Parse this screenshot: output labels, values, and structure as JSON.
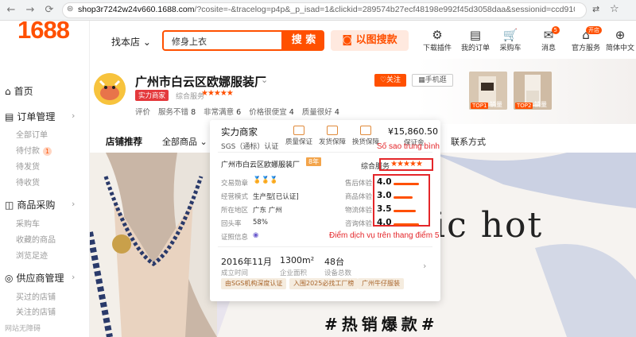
{
  "browser": {
    "url_host": "shop3r7242w24v660.1688.com",
    "url_rest": "/?cosite=-&tracelog=p4p&_p_isad=1&clickid=289574b27ecf48198e992f45d3058daa&sessionid=ccd91063c73c9895..."
  },
  "sidebar": {
    "logo": "1688",
    "home": "首页",
    "orders_head": "订单管理",
    "orders_items": [
      "全部订单",
      "待付款",
      "待发货",
      "待收货"
    ],
    "pending_count": "1",
    "purchase_head": "商品采购",
    "purchase_items": [
      "采购车",
      "收藏的商品",
      "浏览足迹"
    ],
    "supplier_head": "供应商管理",
    "supplier_items": [
      "买过的店铺",
      "关注的店铺"
    ],
    "watermark": "网站无障碍"
  },
  "header": {
    "find_shop": "找本店",
    "search_value": "修身上衣",
    "search_btn": "搜 索",
    "image_search": "以图搜款",
    "icons": [
      {
        "label": "下载插件",
        "icon": "download-plugin-icon"
      },
      {
        "label": "我的订单",
        "icon": "orders-icon"
      },
      {
        "label": "采购车",
        "icon": "cart-icon"
      },
      {
        "label": "消息",
        "icon": "message-icon",
        "badge": "5"
      },
      {
        "label": "官方服务",
        "icon": "service-icon",
        "badge": "开店"
      },
      {
        "label": "简体中文",
        "icon": "language-icon"
      }
    ]
  },
  "shop": {
    "name": "广州市白云区欧娜服装厂",
    "tag": "实力商家",
    "mix_label": "综合服务",
    "stars": "★★★★★",
    "metrics": [
      {
        "label": "评价",
        "value": ""
      },
      {
        "label": "服务不错",
        "value": "8"
      },
      {
        "label": "非常满意",
        "value": "6"
      },
      {
        "label": "价格很便宜",
        "value": "4"
      },
      {
        "label": "质量很好",
        "value": "4"
      }
    ],
    "follow": "关注",
    "mobile": "手机逛",
    "top1": "TOP1",
    "top2": "TOP2",
    "sales": "销量"
  },
  "nav": {
    "recommend": "店铺推荐",
    "all": "全部商品",
    "contact": "联系方式"
  },
  "banner": {
    "text": "ic hot",
    "sub": "#热销爆款#"
  },
  "popup": {
    "title": "实力商家",
    "sgs": "SGS（通标）认证",
    "badges": [
      "质量保证",
      "发货保障",
      "换货保障"
    ],
    "amount": "¥15,860.50",
    "deposit": "保证金",
    "company": "广州市白云区欧娜服装厂",
    "years": "8年",
    "overall": "综合服务",
    "overall_stars": "★★★★★",
    "info": [
      {
        "label": "交易勋章",
        "value": "🏅🏅🏅"
      },
      {
        "label": "经营模式",
        "value": "生产型[已认证]"
      },
      {
        "label": "所在地区",
        "value": "广东 广州"
      },
      {
        "label": "回头率",
        "value": "58%"
      },
      {
        "label": "证照信息",
        "value": "◉"
      }
    ],
    "ratings": [
      {
        "label": "售后体验",
        "score": "4.0",
        "fill": 0.8
      },
      {
        "label": "商品体验",
        "score": "3.0",
        "fill": 0.6
      },
      {
        "label": "物流体验",
        "score": "3.5",
        "fill": 0.7
      },
      {
        "label": "咨询体验",
        "score": "4.0",
        "fill": 0.8
      }
    ],
    "stats": [
      {
        "value": "2016年11月",
        "label": "成立时间"
      },
      {
        "value": "1300m²",
        "label": "企业面积"
      },
      {
        "value": "48台",
        "label": "设备总数"
      }
    ],
    "chips": [
      "由SGS机构深度认证",
      "入围2025必找工厂榜",
      "广州牛仔服装"
    ]
  },
  "annotations": {
    "note1": "Số sao trung bình",
    "note2": "Điểm dịch vụ trên thang điểm 5",
    "color": "#e4262a"
  }
}
